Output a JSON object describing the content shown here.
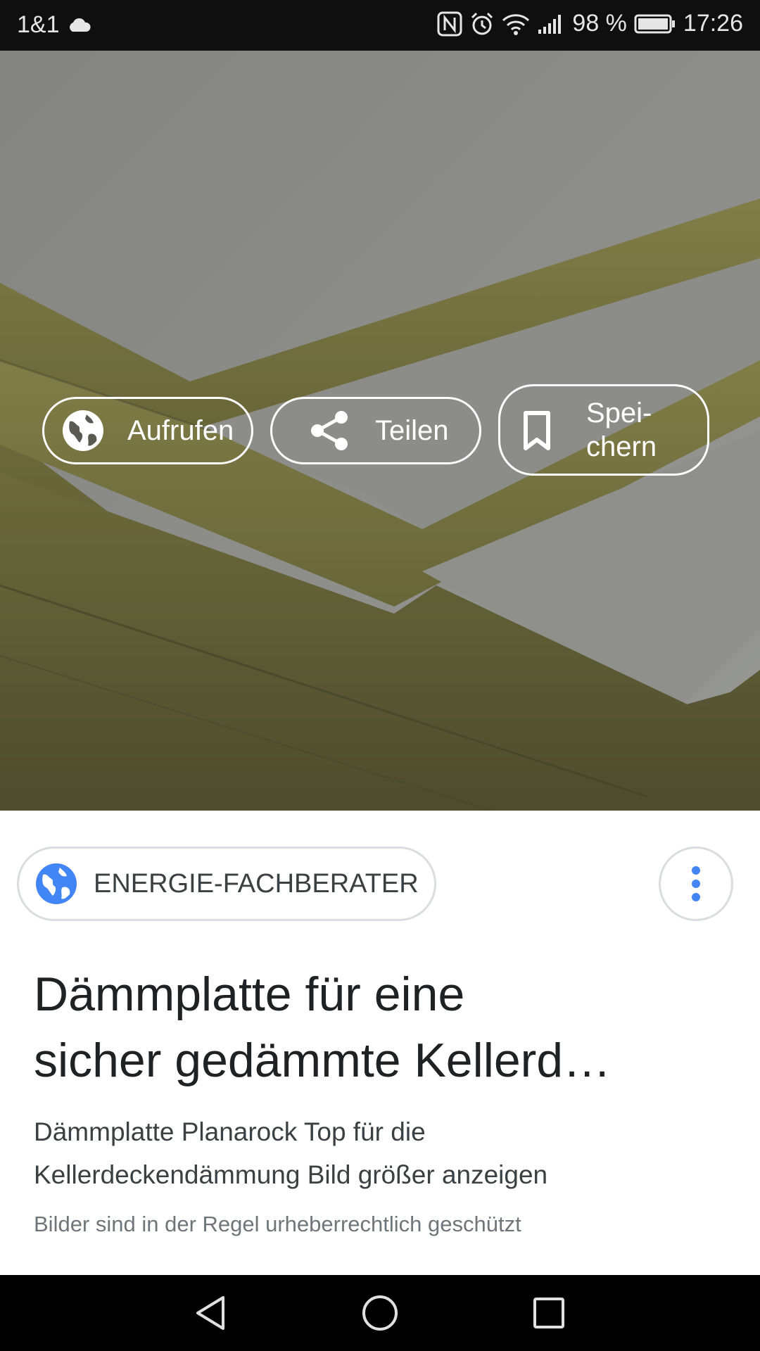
{
  "status_bar": {
    "carrier": "1&1",
    "battery": "98 %",
    "time": "17:26",
    "icons": [
      "cloud-icon",
      "nfc-icon",
      "alarm-icon",
      "wifi-icon",
      "signal-icon",
      "battery-icon"
    ]
  },
  "image": {
    "subject": "mineral-wool-insulation-boards",
    "colors": {
      "wool": "#8c8a50",
      "board_top": "#a5a6a1"
    }
  },
  "actions": {
    "visit_label": "Aufrufen",
    "share_label": "Teilen",
    "save_label": "Spei-\nchern"
  },
  "result": {
    "source": "ENERGIE-FACHBERATER",
    "title_line1": "Dämmplatte für eine",
    "title_line2": "sicher gedämmte Kellerd…",
    "description_line1": "Dämmplatte Planarock Top für die",
    "description_line2": "Kellerdeckendämmung Bild größer anzeigen",
    "copyright_notice": "Bilder sind in der Regel urheberrechtlich geschützt"
  },
  "theme": {
    "accent": "#4285f4",
    "status_bar_bg": "#0f0f0f",
    "nav_bar_bg": "#000000"
  },
  "nav_bar": {
    "icons": [
      "back-icon",
      "home-icon",
      "recents-icon"
    ]
  }
}
